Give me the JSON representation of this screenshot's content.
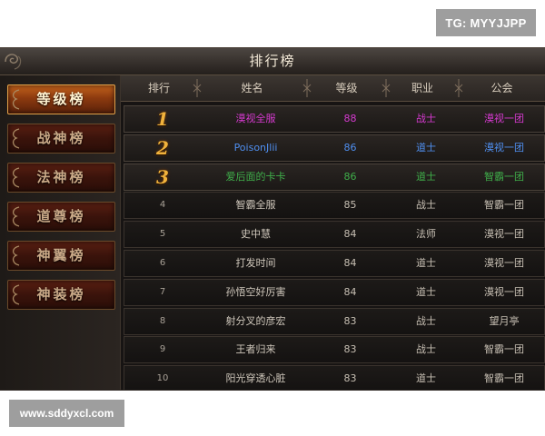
{
  "watermark": {
    "top": "TG: MYYJJPP",
    "bottom": "www.sddyxcl.com"
  },
  "panel_title": "排行榜",
  "categories": [
    {
      "label": "等级榜",
      "active": true
    },
    {
      "label": "战神榜",
      "active": false
    },
    {
      "label": "法神榜",
      "active": false
    },
    {
      "label": "道尊榜",
      "active": false
    },
    {
      "label": "神翼榜",
      "active": false
    },
    {
      "label": "神装榜",
      "active": false
    }
  ],
  "columns": [
    "排行",
    "姓名",
    "等级",
    "职业",
    "公会"
  ],
  "rows": [
    {
      "rank": "1",
      "name": "漠视全服",
      "level": "88",
      "job": "战士",
      "guild": "漠视一团",
      "color": "#d63ad0"
    },
    {
      "rank": "2",
      "name": "PoisonJlii",
      "level": "86",
      "job": "道士",
      "guild": "漠视一团",
      "color": "#4f8ff0"
    },
    {
      "rank": "3",
      "name": "爱后面的卡卡",
      "level": "86",
      "job": "道士",
      "guild": "智霸一团",
      "color": "#3fae4a"
    },
    {
      "rank": "4",
      "name": "智霸全服",
      "level": "85",
      "job": "战士",
      "guild": "智霸一团",
      "color": "#cfc7bb"
    },
    {
      "rank": "5",
      "name": "史中慧",
      "level": "84",
      "job": "法师",
      "guild": "漠视一团",
      "color": "#cfc7bb"
    },
    {
      "rank": "6",
      "name": "打发时间",
      "level": "84",
      "job": "道士",
      "guild": "漠视一团",
      "color": "#cfc7bb"
    },
    {
      "rank": "7",
      "name": "孙悟空好厉害",
      "level": "84",
      "job": "道士",
      "guild": "漠视一团",
      "color": "#cfc7bb"
    },
    {
      "rank": "8",
      "name": "射分叉的彦宏",
      "level": "83",
      "job": "战士",
      "guild": "望月亭",
      "color": "#cfc7bb"
    },
    {
      "rank": "9",
      "name": "王者归来",
      "level": "83",
      "job": "战士",
      "guild": "智霸一团",
      "color": "#cfc7bb"
    },
    {
      "rank": "10",
      "name": "阳光穿透心脏",
      "level": "83",
      "job": "道士",
      "guild": "智霸一团",
      "color": "#cfc7bb"
    }
  ]
}
